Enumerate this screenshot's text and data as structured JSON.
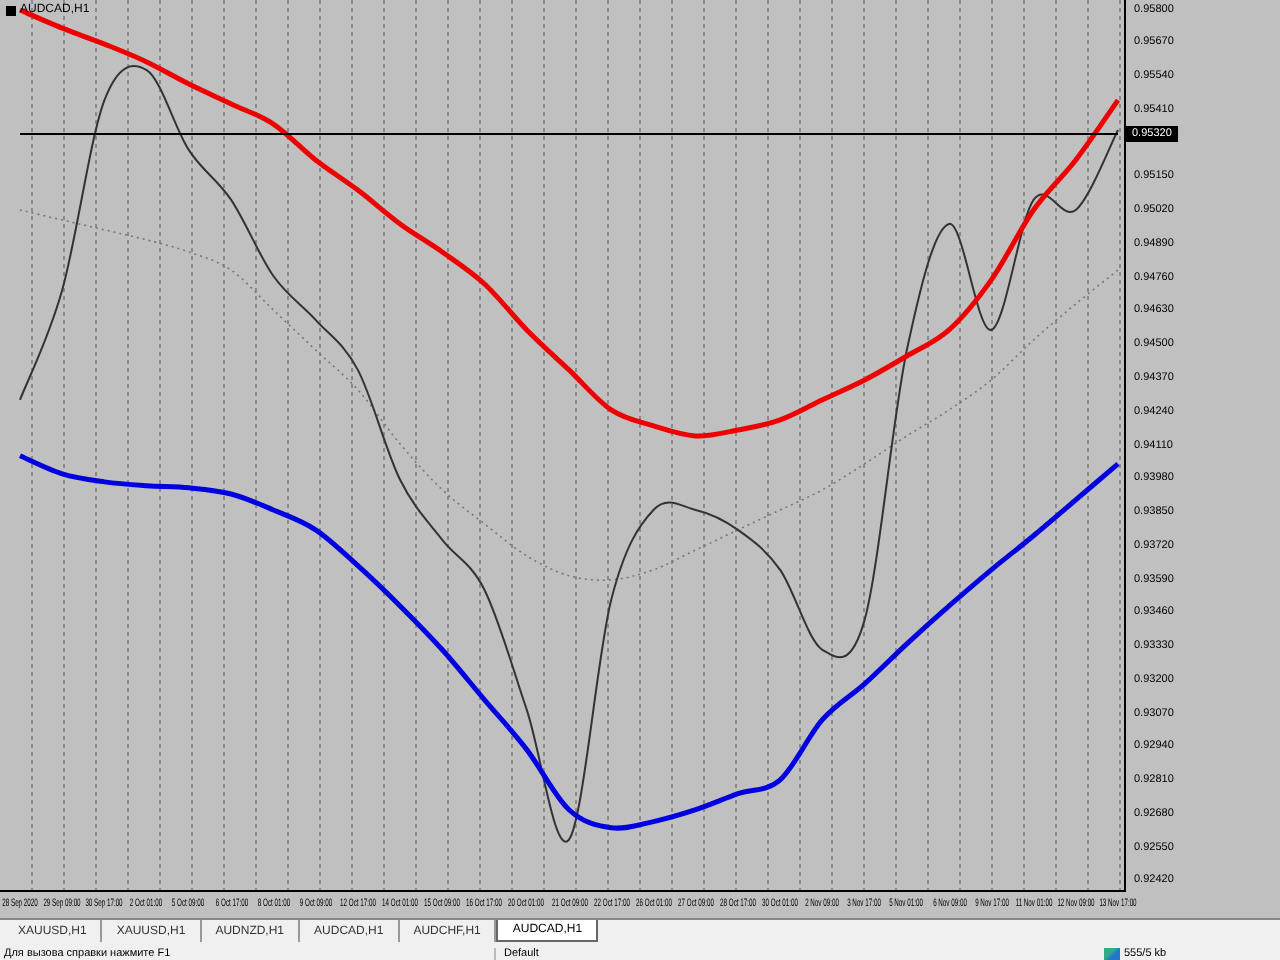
{
  "chart": {
    "title": "AUDCAD,H1",
    "current_price": "0.95320",
    "chart_data": {
      "type": "line",
      "grid": true,
      "ylim": [
        0.92381,
        0.95839
      ],
      "x": [
        "28 Sep 2020",
        "29 Sep 09:00",
        "30 Sep 17:00",
        "2 Oct 01:00",
        "5 Oct 09:00",
        "6 Oct 17:00",
        "8 Oct 01:00",
        "9 Oct 09:00",
        "12 Oct 17:00",
        "14 Oct 01:00",
        "15 Oct 09:00",
        "16 Oct 17:00",
        "20 Oct 01:00",
        "21 Oct 09:00",
        "22 Oct 17:00",
        "26 Oct 01:00",
        "27 Oct 09:00",
        "28 Oct 17:00",
        "30 Oct 01:00",
        "2 Nov 09:00",
        "3 Nov 17:00",
        "5 Nov 01:00",
        "6 Nov 09:00",
        "9 Nov 17:00",
        "11 Nov 01:00",
        "12 Nov 09:00",
        "13 Nov 17:00"
      ],
      "yticks": [
        {
          "value": 0.958,
          "label": "0.95800"
        },
        {
          "value": 0.9567,
          "label": "0.95670"
        },
        {
          "value": 0.9554,
          "label": "0.95540"
        },
        {
          "value": 0.9541,
          "label": "0.95410"
        },
        {
          "value": 0.9515,
          "label": "0.95150"
        },
        {
          "value": 0.9502,
          "label": "0.95020"
        },
        {
          "value": 0.9489,
          "label": "0.94890"
        },
        {
          "value": 0.9476,
          "label": "0.94760"
        },
        {
          "value": 0.9463,
          "label": "0.94630"
        },
        {
          "value": 0.945,
          "label": "0.94500"
        },
        {
          "value": 0.9437,
          "label": "0.94370"
        },
        {
          "value": 0.9424,
          "label": "0.94240"
        },
        {
          "value": 0.9411,
          "label": "0.94110"
        },
        {
          "value": 0.9398,
          "label": "0.93980"
        },
        {
          "value": 0.9385,
          "label": "0.93850"
        },
        {
          "value": 0.9372,
          "label": "0.93720"
        },
        {
          "value": 0.9359,
          "label": "0.93590"
        },
        {
          "value": 0.9346,
          "label": "0.93460"
        },
        {
          "value": 0.9333,
          "label": "0.93330"
        },
        {
          "value": 0.932,
          "label": "0.93200"
        },
        {
          "value": 0.9307,
          "label": "0.93070"
        },
        {
          "value": 0.9294,
          "label": "0.92940"
        },
        {
          "value": 0.9281,
          "label": "0.92810"
        },
        {
          "value": 0.9268,
          "label": "0.92680"
        },
        {
          "value": 0.9255,
          "label": "0.92550"
        },
        {
          "value": 0.9242,
          "label": "0.92420"
        }
      ],
      "series": [
        {
          "color": "#777777",
          "line_style": "dotted",
          "values": [
            0.95025,
            0.94986,
            0.94948,
            0.94909,
            0.94862,
            0.94792,
            0.94637,
            0.94482,
            0.94328,
            0.94118,
            0.9394,
            0.93808,
            0.93684,
            0.93607,
            0.93591,
            0.9363,
            0.93707,
            0.93785,
            0.93862,
            0.9394,
            0.94041,
            0.94149,
            0.9425,
            0.94366,
            0.94521,
            0.94661,
            0.94792
          ]
        },
        {
          "color": "#333333",
          "values": [
            0.94289,
            0.94715,
            0.95451,
            0.95567,
            0.95257,
            0.95064,
            0.94769,
            0.94599,
            0.94405,
            0.93979,
            0.93746,
            0.93552,
            0.93087,
            0.92584,
            0.93514,
            0.93862,
            0.93862,
            0.93785,
            0.9363,
            0.9332,
            0.93436,
            0.94482,
            0.94971,
            0.9456,
            0.95064,
            0.95025,
            0.95335
          ]
        },
        {
          "color": "#ee0000",
          "values": [
            0.958,
            0.9573,
            0.95668,
            0.95599,
            0.95513,
            0.95436,
            0.95358,
            0.95219,
            0.95102,
            0.94971,
            0.94862,
            0.94738,
            0.9456,
            0.94405,
            0.9425,
            0.94188,
            0.94149,
            0.94172,
            0.94211,
            0.94289,
            0.94366,
            0.94459,
            0.9456,
            0.94754,
            0.95025,
            0.95219,
            0.95451
          ]
        },
        {
          "color": "#0000e0",
          "values": [
            0.94072,
            0.94002,
            0.93971,
            0.93956,
            0.93948,
            0.93924,
            0.93862,
            0.93785,
            0.93646,
            0.9349,
            0.9332,
            0.93126,
            0.92933,
            0.927,
            0.9263,
            0.92654,
            0.927,
            0.92762,
            0.92816,
            0.93049,
            0.93188,
            0.93343,
            0.9349,
            0.9363,
            0.93762,
            0.93901,
            0.94041
          ]
        },
        {
          "color": "#000000",
          "values": [
            0.9532,
            0.9532,
            0.9532,
            0.9532,
            0.9532,
            0.9532,
            0.9532,
            0.9532,
            0.9532,
            0.9532,
            0.9532,
            0.9532,
            0.9532,
            0.9532,
            0.9532,
            0.9532,
            0.9532,
            0.9532,
            0.9532,
            0.9532,
            0.9532,
            0.9532,
            0.9532,
            0.9532,
            0.9532,
            0.9532,
            0.9532
          ]
        }
      ]
    }
  },
  "tabs": [
    {
      "label": "XAUUSD,H1",
      "selected": false
    },
    {
      "label": "XAUUSD,H1",
      "selected": false
    },
    {
      "label": "AUDNZD,H1",
      "selected": false
    },
    {
      "label": "AUDCAD,H1",
      "selected": false
    },
    {
      "label": "AUDCHF,H1",
      "selected": false
    },
    {
      "label": "AUDCAD,H1",
      "selected": true
    }
  ],
  "status_bar": {
    "help": "Для вызова справки нажмите F1",
    "profile": "Default",
    "traffic": "555/5 kb"
  }
}
